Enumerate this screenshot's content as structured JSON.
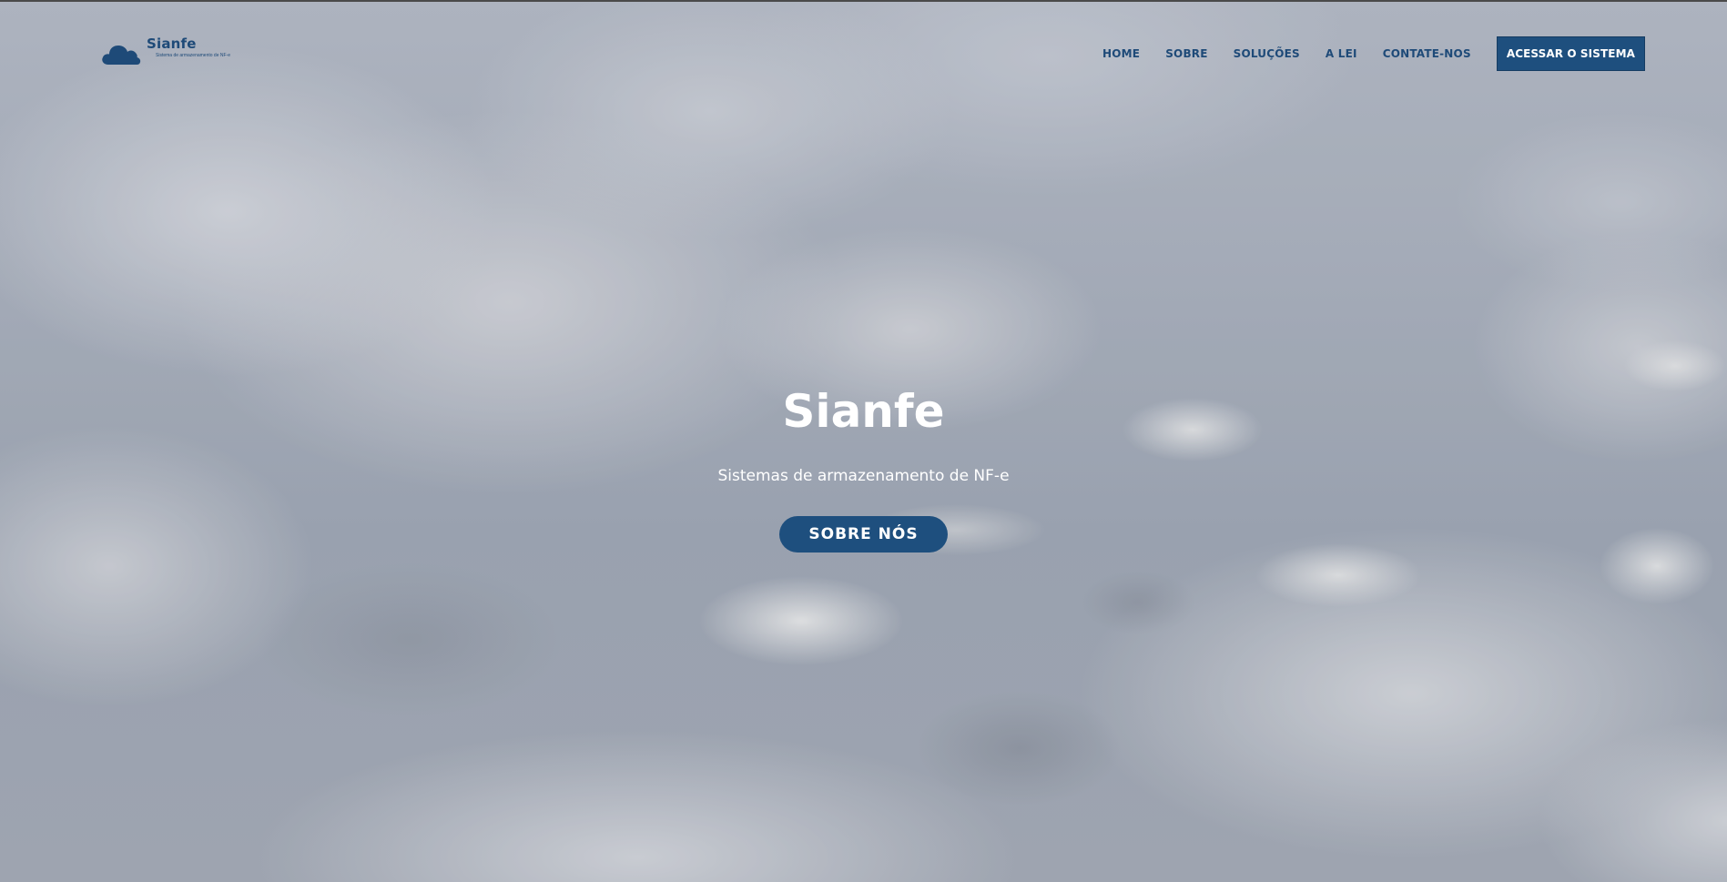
{
  "header": {
    "logo": {
      "name": "Sianfe",
      "tagline": "Sistema de armazenamento de NF-e",
      "icon": "cloud-icon",
      "color": "#1e4a78"
    },
    "nav": [
      {
        "label": "HOME"
      },
      {
        "label": "SOBRE"
      },
      {
        "label": "SOLUÇÕES"
      },
      {
        "label": "A LEI"
      },
      {
        "label": "CONTATE-NOS"
      }
    ],
    "cta_label": "ACESSAR O SISTEMA",
    "accent": "#1e4f7e"
  },
  "hero": {
    "title": "Sianfe",
    "subtitle": "Sistemas de armazenamento de NF-e",
    "button_label": "SOBRE NÓS"
  }
}
